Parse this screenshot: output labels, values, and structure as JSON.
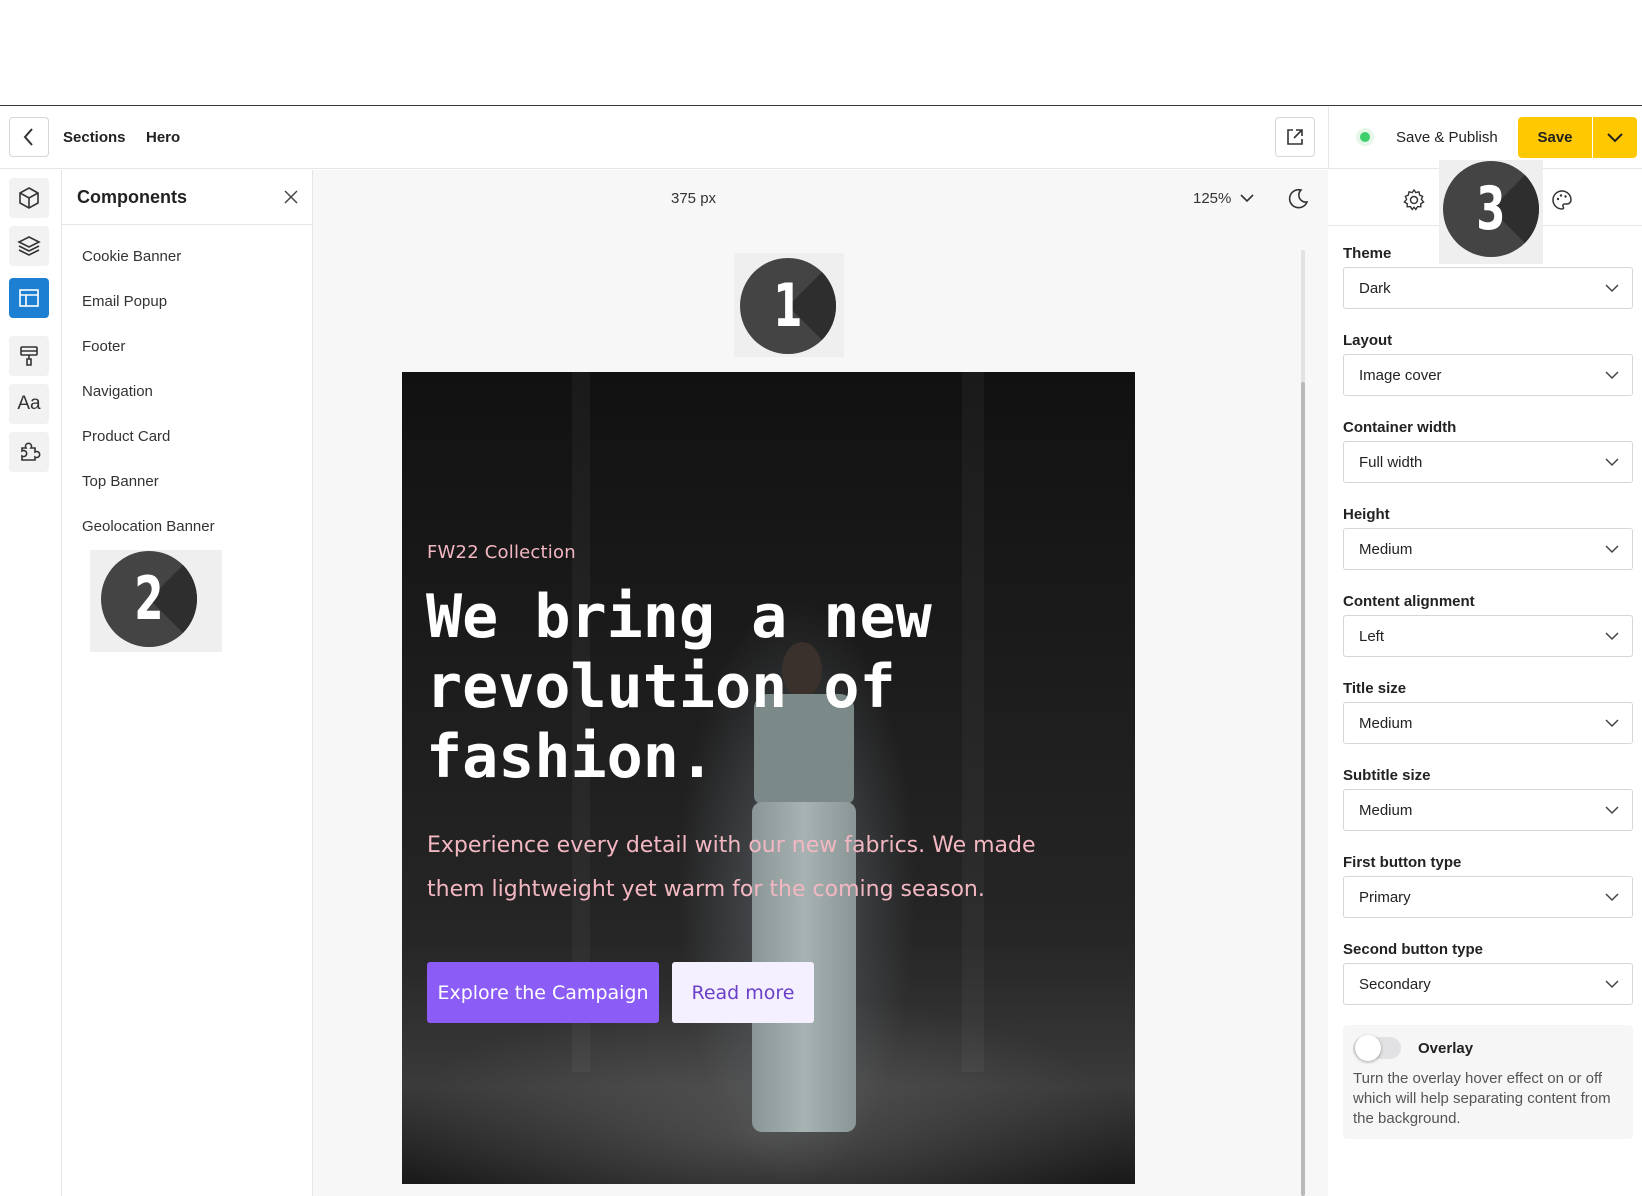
{
  "header": {
    "breadcrumb": [
      "Sections",
      "Hero"
    ],
    "status_text": "Save & Publish",
    "save_label": "Save",
    "accent": "#ffc800"
  },
  "rail": {
    "items": [
      {
        "icon": "cube-icon",
        "active": false
      },
      {
        "icon": "layers-icon",
        "active": false
      },
      {
        "icon": "layout-icon",
        "active": true
      },
      {
        "icon": "paint-roller-icon",
        "active": false
      },
      {
        "icon": "typography-icon",
        "active": false
      },
      {
        "icon": "puzzle-icon",
        "active": false
      }
    ],
    "active_color": "#1d7fd1"
  },
  "components": {
    "title": "Components",
    "items": [
      "Cookie Banner",
      "Email Popup",
      "Footer",
      "Navigation",
      "Product Card",
      "Top Banner",
      "Geolocation Banner"
    ]
  },
  "canvas": {
    "width_label": "375 px",
    "zoom_label": "125%",
    "badges": [
      "1",
      "2",
      "3"
    ]
  },
  "hero": {
    "eyebrow": "FW22 Collection",
    "title": "We bring a new revolution of fashion.",
    "subtitle": "Experience every detail with our new fabrics. We made them lightweight yet warm for the coming season.",
    "primary_button": "Explore the Campaign",
    "secondary_button": "Read more",
    "primary_color": "#8b5cf6",
    "accent_text_color": "#f3b7c2"
  },
  "settings": {
    "tabs": [
      "gear-icon",
      "palette-icon"
    ],
    "fields": [
      {
        "label": "Theme",
        "value": "Dark"
      },
      {
        "label": "Layout",
        "value": "Image cover"
      },
      {
        "label": "Container width",
        "value": "Full width"
      },
      {
        "label": "Height",
        "value": "Medium"
      },
      {
        "label": "Content alignment",
        "value": "Left"
      },
      {
        "label": "Title size",
        "value": "Medium"
      },
      {
        "label": "Subtitle size",
        "value": "Medium"
      },
      {
        "label": "First button type",
        "value": "Primary"
      },
      {
        "label": "Second button type",
        "value": "Secondary"
      }
    ],
    "overlay": {
      "label": "Overlay",
      "enabled": false,
      "description": "Turn the overlay hover effect on or off which will help separating content from the background."
    }
  }
}
